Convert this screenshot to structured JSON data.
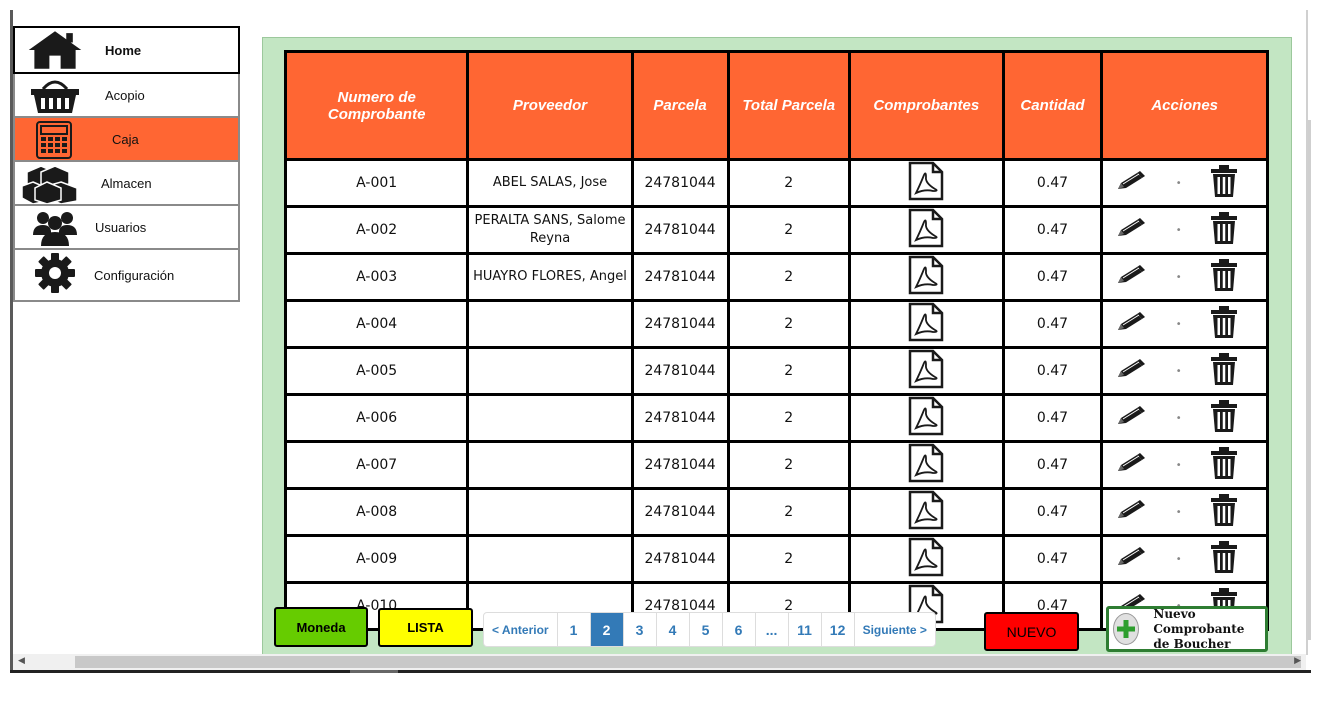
{
  "sidebar": {
    "items": [
      {
        "label": "Home",
        "icon": "home-icon"
      },
      {
        "label": "Acopio",
        "icon": "basket-icon"
      },
      {
        "label": "Caja",
        "icon": "calculator-icon"
      },
      {
        "label": "Almacen",
        "icon": "boxes-icon"
      },
      {
        "label": "Usuarios",
        "icon": "users-icon"
      },
      {
        "label": "Configuración",
        "icon": "gear-icon"
      }
    ]
  },
  "table": {
    "headers": [
      "Numero de Comprobante",
      "Proveedor",
      "Parcela",
      "Total Parcela",
      "Comprobantes",
      "Cantidad",
      "Acciones"
    ],
    "rows": [
      {
        "numero": "A-001",
        "proveedor": "ABEL SALAS, Jose",
        "parcela": "24781044",
        "total": "2",
        "cantidad": "0.47"
      },
      {
        "numero": "A-002",
        "proveedor": "PERALTA SANS, Salome Reyna",
        "parcela": "24781044",
        "total": "2",
        "cantidad": "0.47"
      },
      {
        "numero": "A-003",
        "proveedor": "HUAYRO FLORES, Angel",
        "parcela": "24781044",
        "total": "2",
        "cantidad": "0.47"
      },
      {
        "numero": "A-004",
        "proveedor": "",
        "parcela": "24781044",
        "total": "2",
        "cantidad": "0.47"
      },
      {
        "numero": "A-005",
        "proveedor": "",
        "parcela": "24781044",
        "total": "2",
        "cantidad": "0.47"
      },
      {
        "numero": "A-006",
        "proveedor": "",
        "parcela": "24781044",
        "total": "2",
        "cantidad": "0.47"
      },
      {
        "numero": "A-007",
        "proveedor": "",
        "parcela": "24781044",
        "total": "2",
        "cantidad": "0.47"
      },
      {
        "numero": "A-008",
        "proveedor": "",
        "parcela": "24781044",
        "total": "2",
        "cantidad": "0.47"
      },
      {
        "numero": "A-009",
        "proveedor": "",
        "parcela": "24781044",
        "total": "2",
        "cantidad": "0.47"
      },
      {
        "numero": "A-010",
        "proveedor": "",
        "parcela": "24781044",
        "total": "2",
        "cantidad": "0.47"
      }
    ]
  },
  "buttons": {
    "moneda": "Moneda",
    "lista": "LISTA",
    "nuevo": "NUEVO",
    "boucher_line1": "Nuevo Comprobante",
    "boucher_line2": "de Boucher"
  },
  "pagination": {
    "prev": "< Anterior",
    "pages": [
      "1",
      "2",
      "3",
      "4",
      "5",
      "6",
      "...",
      "11",
      "12"
    ],
    "current": "2",
    "next": "Siguiente >"
  },
  "colors": {
    "header_bg": "#ff6633",
    "active_sidebar": "#ff6633",
    "panel_bg": "#c3e6c3",
    "moneda": "#66cc00",
    "lista": "#ffff00",
    "nuevo": "#ff0000",
    "pager_active": "#337ab7"
  }
}
